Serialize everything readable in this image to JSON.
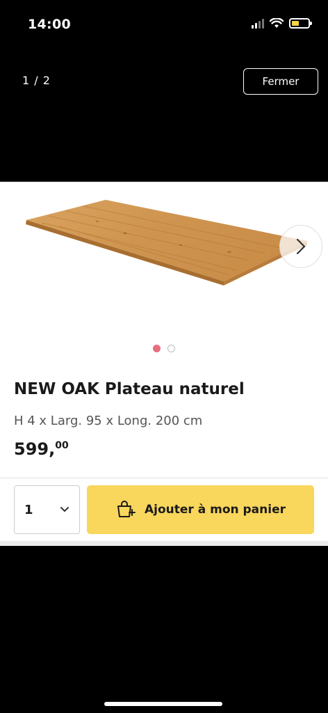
{
  "status_bar": {
    "time": "14:00",
    "battery_color": "#f5d547"
  },
  "viewer": {
    "counter": "1 / 2",
    "close_label": "Fermer"
  },
  "carousel": {
    "current_index": 1,
    "total": 2,
    "active_dot_color": "#e86d7b"
  },
  "product": {
    "title": "NEW OAK Plateau naturel",
    "dimensions": "H 4 x Larg. 95 x Long. 200 cm",
    "price_main": "599,",
    "price_cents": "00"
  },
  "cart": {
    "quantity": "1",
    "add_label": "Ajouter à mon panier",
    "button_color": "#f9d65c"
  },
  "icons": {
    "next": "chevron-right-icon",
    "cart": "cart-add-icon",
    "dropdown": "chevron-down-icon"
  }
}
